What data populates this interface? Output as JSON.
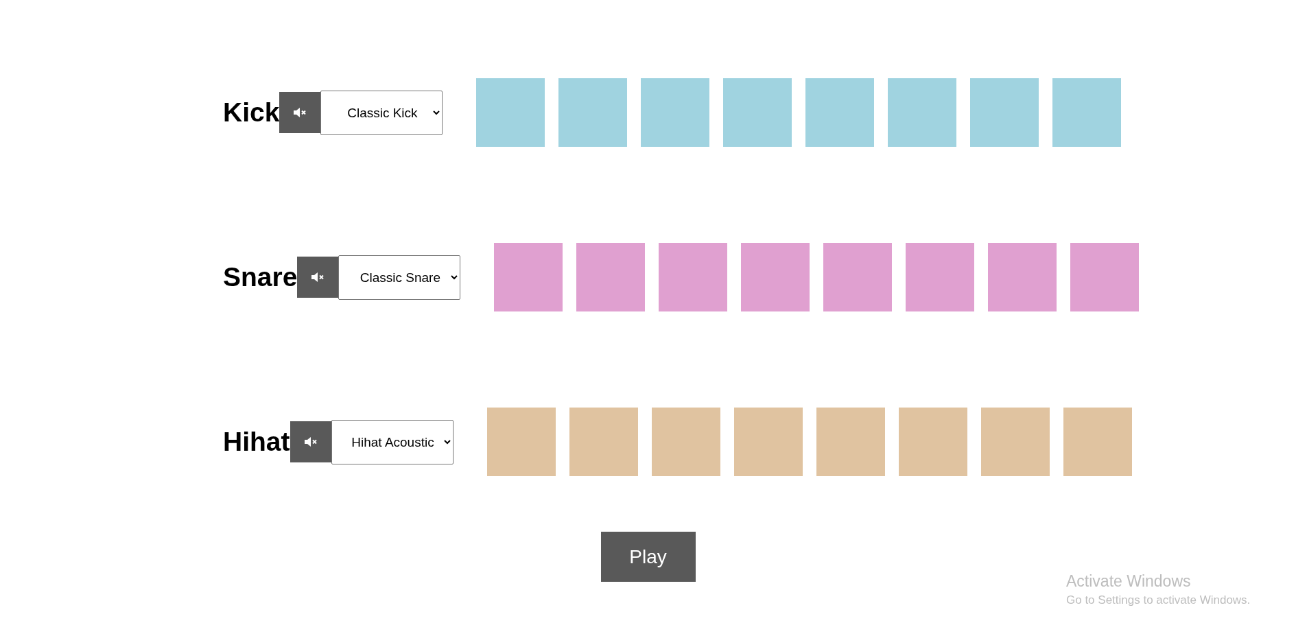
{
  "tracks": [
    {
      "name": "Kick",
      "muted": true,
      "sound": "Classic Kick",
      "color": "#a0d3e0",
      "steps": [
        {
          "active": false
        },
        {
          "active": false
        },
        {
          "active": false
        },
        {
          "active": false
        },
        {
          "active": false
        },
        {
          "active": false
        },
        {
          "active": false
        },
        {
          "active": false
        }
      ]
    },
    {
      "name": "Snare",
      "muted": true,
      "sound": "Classic Snare",
      "color": "#e0a0d0",
      "steps": [
        {
          "active": false
        },
        {
          "active": false
        },
        {
          "active": false
        },
        {
          "active": false
        },
        {
          "active": false
        },
        {
          "active": false
        },
        {
          "active": false
        },
        {
          "active": false
        }
      ]
    },
    {
      "name": "Hihat",
      "muted": true,
      "sound": "Hihat Acoustic",
      "color": "#e0c3a0",
      "steps": [
        {
          "active": false
        },
        {
          "active": false
        },
        {
          "active": false
        },
        {
          "active": false
        },
        {
          "active": false
        },
        {
          "active": false
        },
        {
          "active": false
        },
        {
          "active": false
        }
      ]
    }
  ],
  "play_button": "Play",
  "os_notice": {
    "title": "Activate Windows",
    "subtitle": "Go to Settings to activate Windows."
  }
}
